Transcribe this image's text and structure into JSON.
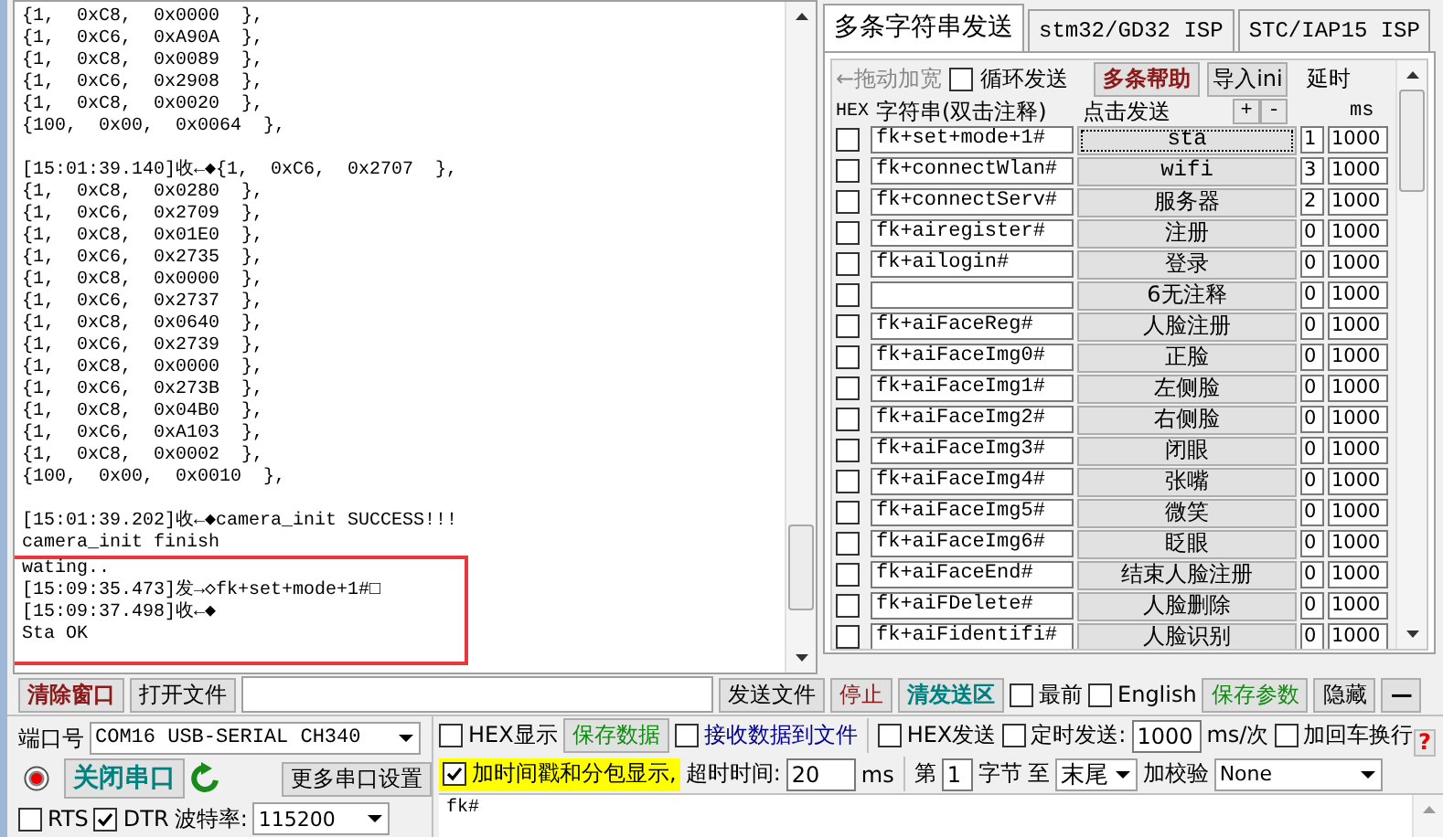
{
  "receive_log": {
    "lines": [
      {
        "text": "{1,  0xC8,  0x0000  },",
        "highlighted": false
      },
      {
        "text": "{1,  0xC6,  0xA90A  },",
        "highlighted": false
      },
      {
        "text": "{1,  0xC8,  0x0089  },",
        "highlighted": false
      },
      {
        "text": "{1,  0xC6,  0x2908  },",
        "highlighted": false
      },
      {
        "text": "{1,  0xC8,  0x0020  },",
        "highlighted": false
      },
      {
        "text": "{100,  0x00,  0x0064  },",
        "highlighted": false
      },
      {
        "kind": "blank"
      },
      {
        "text": "[15:01:39.140]收←◆{1,  0xC6,  0x2707  },",
        "highlighted": false
      },
      {
        "text": "{1,  0xC8,  0x0280  },",
        "highlighted": false
      },
      {
        "text": "{1,  0xC6,  0x2709  },",
        "highlighted": false
      },
      {
        "text": "{1,  0xC8,  0x01E0  },",
        "highlighted": false
      },
      {
        "text": "{1,  0xC6,  0x2735  },",
        "highlighted": false
      },
      {
        "text": "{1,  0xC8,  0x0000  },",
        "highlighted": false
      },
      {
        "text": "{1,  0xC6,  0x2737  },",
        "highlighted": false
      },
      {
        "text": "{1,  0xC8,  0x0640  },",
        "highlighted": false
      },
      {
        "text": "{1,  0xC6,  0x2739  },",
        "highlighted": false
      },
      {
        "text": "{1,  0xC8,  0x0000  },",
        "highlighted": false
      },
      {
        "text": "{1,  0xC6,  0x273B  },",
        "highlighted": false
      },
      {
        "text": "{1,  0xC8,  0x04B0  },",
        "highlighted": false
      },
      {
        "text": "{1,  0xC6,  0xA103  },",
        "highlighted": false
      },
      {
        "text": "{1,  0xC8,  0x0002  },",
        "highlighted": false
      },
      {
        "text": "{100,  0x00,  0x0010  },",
        "highlighted": false
      },
      {
        "kind": "blank"
      },
      {
        "text": "[15:01:39.202]收←◆camera_init SUCCESS!!!",
        "highlighted": false
      },
      {
        "text": "camera_init finish",
        "highlighted": false
      },
      {
        "text": "wating..",
        "highlighted": true
      },
      {
        "text": "[15:09:35.473]发→◇fk+set+mode+1#□",
        "highlighted": true
      },
      {
        "text": "[15:09:37.498]收←◆",
        "highlighted": true
      },
      {
        "text": "Sta OK",
        "highlighted": true
      }
    ]
  },
  "tabs": [
    {
      "label": "多条字符串发送",
      "selected": true
    },
    {
      "label": "stm32/GD32 ISP",
      "selected": false
    },
    {
      "label": "STC/IAP15 ISP",
      "selected": false
    }
  ],
  "multi_send": {
    "drag_hint": "←拖动加宽",
    "loop_send": {
      "label": "循环发送",
      "checked": false
    },
    "help_button": "多条帮助",
    "import_button": "导入ini",
    "delay_label": "延时",
    "columns": {
      "hex": "HEX",
      "string": "字符串(双击注释)",
      "send": "点击发送",
      "add": "+",
      "remove": "-",
      "ms": "ms"
    },
    "rows": [
      {
        "hex": false,
        "command": "fk+set+mode+1#",
        "button": "sta",
        "focused": true,
        "order": "1",
        "delay": "1000"
      },
      {
        "hex": false,
        "command": "fk+connectWlan#",
        "button": "wifi",
        "focused": false,
        "order": "3",
        "delay": "1000"
      },
      {
        "hex": false,
        "command": "fk+connectServ#",
        "button": "服务器",
        "focused": false,
        "order": "2",
        "delay": "1000"
      },
      {
        "hex": false,
        "command": "fk+airegister#",
        "button": "注册",
        "focused": false,
        "order": "0",
        "delay": "1000"
      },
      {
        "hex": false,
        "command": "fk+ailogin#",
        "button": "登录",
        "focused": false,
        "order": "0",
        "delay": "1000"
      },
      {
        "hex": false,
        "button": "6无注释",
        "focused": false,
        "order": "0",
        "delay": "1000"
      },
      {
        "hex": false,
        "command": "fk+aiFaceReg#",
        "button": "人脸注册",
        "focused": false,
        "order": "0",
        "delay": "1000"
      },
      {
        "hex": false,
        "command": "fk+aiFaceImg0#",
        "button": "正脸",
        "focused": false,
        "order": "0",
        "delay": "1000"
      },
      {
        "hex": false,
        "command": "fk+aiFaceImg1#",
        "button": "左侧脸",
        "focused": false,
        "order": "0",
        "delay": "1000"
      },
      {
        "hex": false,
        "command": "fk+aiFaceImg2#",
        "button": "右侧脸",
        "focused": false,
        "order": "0",
        "delay": "1000"
      },
      {
        "hex": false,
        "command": "fk+aiFaceImg3#",
        "button": "闭眼",
        "focused": false,
        "order": "0",
        "delay": "1000"
      },
      {
        "hex": false,
        "command": "fk+aiFaceImg4#",
        "button": "张嘴",
        "focused": false,
        "order": "0",
        "delay": "1000"
      },
      {
        "hex": false,
        "command": "fk+aiFaceImg5#",
        "button": "微笑",
        "focused": false,
        "order": "0",
        "delay": "1000"
      },
      {
        "hex": false,
        "command": "fk+aiFaceImg6#",
        "button": "眨眼",
        "focused": false,
        "order": "0",
        "delay": "1000"
      },
      {
        "hex": false,
        "command": "fk+aiFaceEnd#",
        "button": "结束人脸注册",
        "focused": false,
        "order": "0",
        "delay": "1000"
      },
      {
        "hex": false,
        "command": "fk+aiFDelete#",
        "button": "人脸删除",
        "focused": false,
        "order": "0",
        "delay": "1000"
      },
      {
        "hex": false,
        "command": "fk+aiFidentifi#",
        "button": "人脸识别",
        "focused": false,
        "order": "0",
        "delay": "1000"
      }
    ]
  },
  "toolbar": {
    "clear_button": "清除窗口",
    "open_file_button": "打开文件",
    "send_file_button": "发送文件",
    "stop_button": "停止",
    "clear_send_button": "清发送区",
    "topmost": {
      "label": "最前",
      "checked": false
    },
    "english": {
      "label": "English",
      "checked": false
    },
    "save_params_button": "保存参数",
    "hide_button": "隐藏",
    "minimize_button": "—"
  },
  "port": {
    "label": "端口号",
    "value": "COM16 USB-SERIAL CH340",
    "close_button": "关闭串口",
    "more_settings_button": "更多串口设置",
    "rts": {
      "label": "RTS",
      "checked": false
    },
    "dtr": {
      "label": "DTR",
      "checked": true
    },
    "baud_label": "波特率:",
    "baud": "115200"
  },
  "options": {
    "hex_display": {
      "label": "HEX显示",
      "checked": false
    },
    "save_data_button": "保存数据",
    "receive_to_file": {
      "label": "接收数据到文件",
      "checked": false
    },
    "hex_send": {
      "label": "HEX发送",
      "checked": false
    },
    "timed_send": {
      "label": "定时发送:",
      "checked": false
    },
    "interval": "1000",
    "interval_unit": "ms/次",
    "append_newline": {
      "label": "加回车换行",
      "checked": false
    },
    "help_mark": "?",
    "timestamp": {
      "label": "加时间戳和分包显示,",
      "checked": true
    },
    "timeout_label": "超时时间:",
    "timeout": "20",
    "timeout_unit": "ms",
    "byte_from_label": "第",
    "byte_from": "1",
    "byte_label": "字节",
    "to_label": "至",
    "byte_to": "末尾",
    "checksum_label": "加校验",
    "checksum": "None"
  },
  "send_text": "fk#"
}
